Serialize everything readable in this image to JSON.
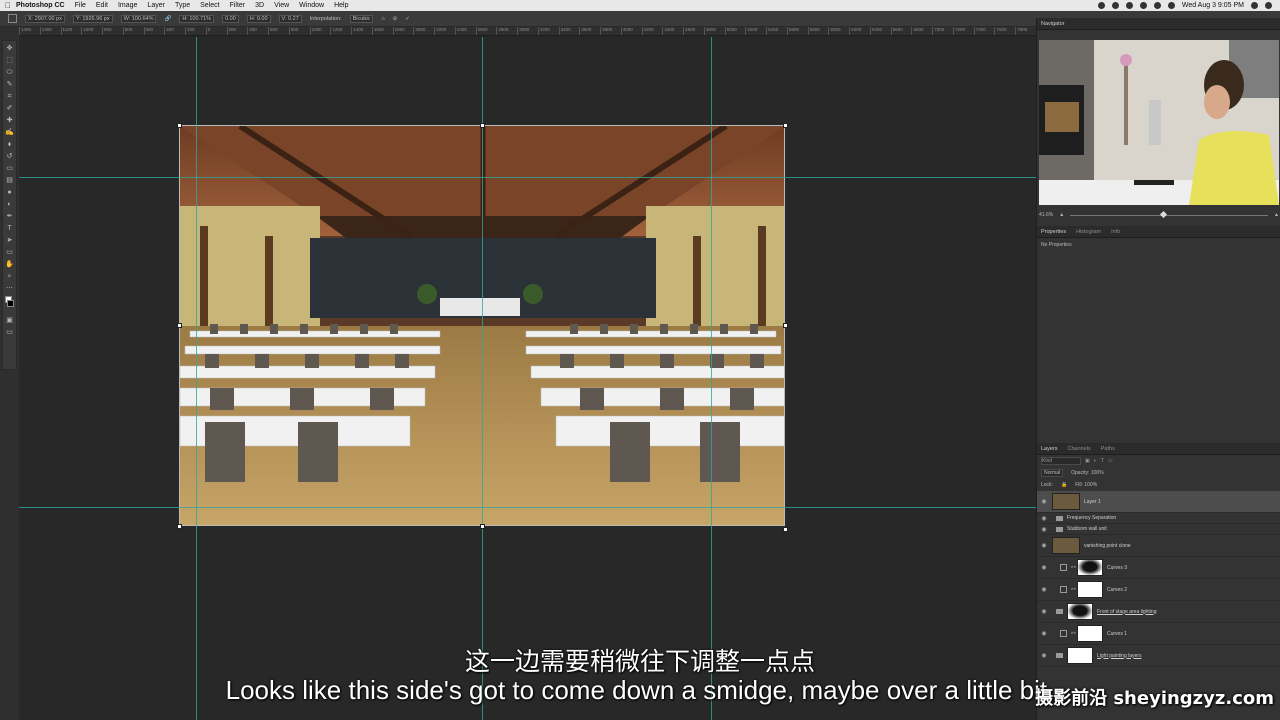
{
  "menubar": {
    "app_name": "Photoshop CC",
    "items": [
      "File",
      "Edit",
      "Image",
      "Layer",
      "Type",
      "Select",
      "Filter",
      "3D",
      "View",
      "Window",
      "Help"
    ],
    "clock": "Wed Aug 3  9:05 PM"
  },
  "options_bar": {
    "x": "X: 2907.00 px",
    "y": "Y: 1926.96 px",
    "w": "W: 100.64%",
    "h": "H: 100.71%",
    "angle": "0.00",
    "h_skew": "H: 0.00",
    "v_skew": "V: 0.27",
    "interpolation_label": "Interpolation:",
    "interpolation_value": "Bicubic"
  },
  "ruler": {
    "ticks": [
      "1400",
      "1300",
      "1100",
      "1000",
      "900",
      "800",
      "600",
      "400",
      "200",
      "0",
      "200",
      "400",
      "600",
      "800",
      "1000",
      "1250",
      "1400",
      "1600",
      "1800",
      "2000",
      "2200",
      "2400",
      "2600",
      "2800",
      "3000",
      "3200",
      "3400",
      "3600",
      "3800",
      "4000",
      "4200",
      "4400",
      "4600",
      "4800",
      "5000",
      "5200",
      "5400",
      "5600",
      "5800",
      "6000",
      "6200",
      "6400",
      "6600",
      "6800",
      "7000",
      "7200",
      "7400",
      "7600",
      "7800"
    ]
  },
  "panels": {
    "navigator_tab": "Navigator",
    "zoom_value": "41.6%",
    "properties_tabs": [
      "Properties",
      "Histogram",
      "Info"
    ],
    "properties_body": "No Properties",
    "layers_tabs": [
      "Layers",
      "Channels",
      "Paths"
    ],
    "filter_kind": "Kind",
    "blend_mode": "Normal",
    "opacity": "Opacity: 100%",
    "lock_label": "Lock:",
    "fill": "Fill: 100%",
    "layers": [
      {
        "name": "Layer 1",
        "type": "pixel",
        "selected": true
      },
      {
        "name": "Frequency Separation",
        "type": "group"
      },
      {
        "name": "Stubborn wall unit",
        "type": "group"
      },
      {
        "name": "vanishing point clone",
        "type": "pixel"
      },
      {
        "name": "Curves 3",
        "type": "adjustment",
        "mask": "dark"
      },
      {
        "name": "Curves 2",
        "type": "adjustment",
        "mask": "white"
      },
      {
        "name": "Front of stage area lighting",
        "type": "group-mask",
        "underline": true
      },
      {
        "name": "Curves 1",
        "type": "adjustment",
        "mask": "white"
      },
      {
        "name": "Light painting layers",
        "type": "group-mask",
        "underline": true
      }
    ]
  },
  "subtitles": {
    "cn": "这一边需要稍微往下调整一点点",
    "en": "Looks like this side's got to come down a smidge, maybe over a little bit."
  },
  "watermark": "摄影前沿 sheyingzyz.com",
  "colors": {
    "guide": "#2fa89a",
    "canvas_bg": "#282828",
    "panel_bg": "#333333"
  }
}
